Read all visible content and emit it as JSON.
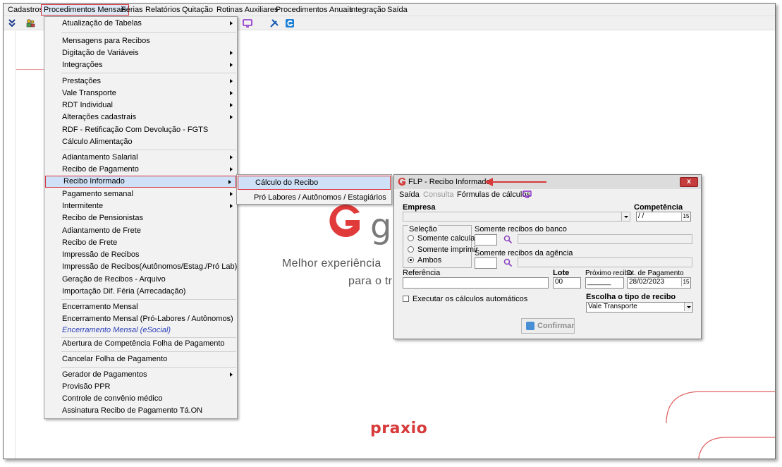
{
  "menubar": {
    "items": [
      "Cadastros",
      "Procedimentos Mensais",
      "Férias",
      "Relatórios",
      "Quitação",
      "Rotinas Auxiliares",
      "Procedimentos Anuais",
      "Integração",
      "Saída"
    ]
  },
  "dropdown": {
    "items": [
      {
        "label": "Atualização de Tabelas",
        "submenu": true
      },
      {
        "label": "Mensagens para Recibos",
        "submenu": false
      },
      {
        "label": "Digitação de Variáveis",
        "submenu": true
      },
      {
        "label": "Integrações",
        "submenu": true
      },
      {
        "label": "Prestações",
        "submenu": true
      },
      {
        "label": "Vale Transporte",
        "submenu": true
      },
      {
        "label": "RDT Individual",
        "submenu": true
      },
      {
        "label": "Alterações cadastrais",
        "submenu": true
      },
      {
        "label": "RDF - Retificação Com Devolução - FGTS",
        "submenu": false
      },
      {
        "label": "Cálculo Alimentação",
        "submenu": false
      },
      {
        "label": "Adiantamento Salarial",
        "submenu": true
      },
      {
        "label": "Recibo de Pagamento",
        "submenu": true
      },
      {
        "label": "Recibo Informado",
        "submenu": true
      },
      {
        "label": "Pagamento semanal",
        "submenu": true
      },
      {
        "label": "Intermitente",
        "submenu": true
      },
      {
        "label": "Recibo de Pensionistas",
        "submenu": false
      },
      {
        "label": "Adiantamento de Frete",
        "submenu": false
      },
      {
        "label": "Recibo de Frete",
        "submenu": false
      },
      {
        "label": "Impressão de Recibos",
        "submenu": false
      },
      {
        "label": "Impressão de Recibos(Autônomos/Estag./Pró Lab)",
        "submenu": false
      },
      {
        "label": "Geração de Recibos - Arquivo",
        "submenu": false
      },
      {
        "label": "Importação Dif. Féria (Arrecadação)",
        "submenu": false
      },
      {
        "label": "Encerramento Mensal",
        "submenu": false
      },
      {
        "label": "Encerramento Mensal (Pró-Labores / Autônomos)",
        "submenu": false
      },
      {
        "label": "Encerramento Mensal (eSocial)",
        "submenu": false
      },
      {
        "label": "Abertura de Competência Folha de Pagamento",
        "submenu": false
      },
      {
        "label": "Cancelar Folha de Pagamento",
        "submenu": false
      },
      {
        "label": "Gerador de Pagamentos",
        "submenu": true
      },
      {
        "label": "Provisão PPR",
        "submenu": false
      },
      {
        "label": "Controle de convênio médico",
        "submenu": false
      },
      {
        "label": "Assinatura Recibo de Pagamento Tá.ON",
        "submenu": false
      }
    ]
  },
  "submenu": {
    "items": [
      "Cálculo do Recibo",
      "Pró Labores / Autônomos / Estagiários"
    ]
  },
  "dialog": {
    "title": "FLP - Recibo Informado",
    "close": "x",
    "menu": {
      "saida": "Saída",
      "consulta": "Consulta",
      "formulas": "Fórmulas de cálculos"
    },
    "empresa_label": "Empresa",
    "competencia_label": "Competência",
    "competencia_value": "/ /",
    "selecao_label": "Seleção",
    "radio_calcular": "Somente calcular",
    "radio_imprimir": "Somente imprimir",
    "radio_ambos": "Ambos",
    "banco_label": "Somente recibos do banco",
    "agencia_label": "Somente recibos da agência",
    "referencia_label": "Referência",
    "lote_label": "Lote",
    "lote_value": "00",
    "proximo_label": "Próximo recibo",
    "proximo_value": "______",
    "dtpag_label": "Dt. de Pagamento",
    "dtpag_value": "28/02/2023",
    "executar_label": "Executar os cálculos automáticos",
    "tipo_label": "Escolha o tipo de recibo",
    "tipo_value": "Vale Transporte",
    "confirm_label": "Confirmar"
  },
  "background": {
    "tagline1": "Melhor experiência",
    "tagline2": "para o tr",
    "brand": "praxio"
  },
  "colors": {
    "accent": "#d9333f",
    "highlight": "#cfe1f7",
    "brand_red": "#d63a3a"
  }
}
